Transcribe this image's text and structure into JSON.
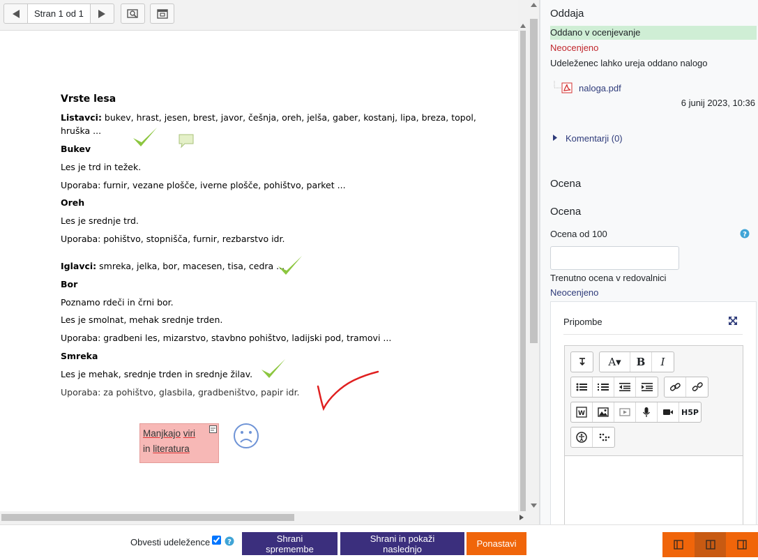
{
  "toolbar": {
    "prev_icon": "arrow-left-icon",
    "page_label": "Stran 1 od 1",
    "next_icon": "arrow-right-icon",
    "search_icon": "search-comments-icon",
    "expand_icon": "expand-window-icon"
  },
  "document": {
    "lines": [
      {
        "text": "Vrste lesa",
        "bold": true
      },
      {
        "label": "Listavci:",
        "text": " bukev, hrast, jesen, brest, javor, češnja, oreh, jelša, gaber, kostanj, lipa, breza, topol,"
      },
      {
        "text": "hruška ..."
      },
      {
        "text": "Bukev",
        "bold": true
      },
      {
        "text": "Les je trd in težek."
      },
      {
        "text": "Uporaba: furnir, vezane plošče, iverne plošče, pohištvo, parket ..."
      },
      {
        "text": "Oreh",
        "bold": true
      },
      {
        "text": "Les je srednje trd."
      },
      {
        "text": "Uporaba: pohištvo, stopnišča, furnir, rezbarstvo idr."
      },
      {
        "label": "Iglavci:",
        "text": " smreka, jelka, bor, macesen, tisa, cedra ..."
      },
      {
        "text": "Bor",
        "bold": true
      },
      {
        "text": "Poznamo rdeči in črni bor."
      },
      {
        "text": "Les je smolnat, mehak srednje trden."
      },
      {
        "text": "Uporaba: gradbeni les, mizarstvo, stavbno pohištvo, ladijski pod, tramovi ..."
      },
      {
        "text": "Smreka",
        "bold": true
      },
      {
        "text": "Les je mehak, srednje trden in srednje žilav."
      },
      {
        "text": "Uporaba: za pohištvo, glasbila, gradbeništvo, papir idr."
      }
    ],
    "note_words": [
      "Manjkajo",
      "viri",
      "in",
      "literatura"
    ]
  },
  "submission": {
    "heading": "Oddaja",
    "status": "Oddano v ocenjevanje",
    "grading_status": "Neocenjeno",
    "edit_note": "Udeleženec lahko ureja oddano nalogo",
    "file_name": "naloga.pdf",
    "file_date": "6 junij 2023, 10:36",
    "comments_link": "Komentarji (0)"
  },
  "grade": {
    "heading": "Ocena",
    "subheading": "Ocena",
    "label": "Ocena od 100",
    "value": "",
    "current_label": "Trenutno ocena v redovalnici",
    "current_value": "Neocenjeno",
    "feedback_title": "Pripombe"
  },
  "footer": {
    "notify_label": "Obvesti udeležence",
    "notify_checked": true,
    "save_label": "Shrani spremembe",
    "save_next_label": "Shrani in pokaži naslednjo",
    "reset_label": "Ponastavi"
  },
  "colors": {
    "accent_purple": "#3b2f7d",
    "accent_orange": "#f0650a",
    "status_green": "#cfeed5",
    "checkmark_green": "#8cc63f",
    "note_pink": "#f7b8b6"
  }
}
